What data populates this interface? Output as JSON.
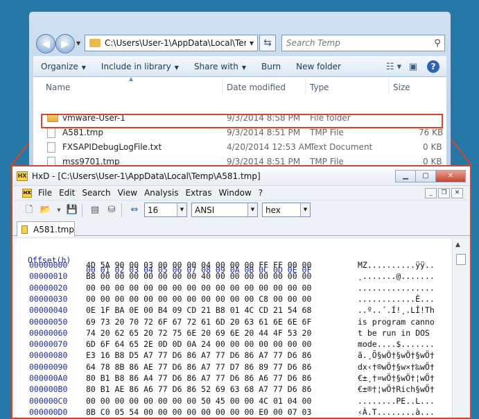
{
  "explorer": {
    "address_path": "C:\\Users\\User-1\\AppData\\Local\\Temp",
    "search_placeholder": "Search Temp",
    "commands": [
      "Organize",
      "Include in library",
      "Share with",
      "Burn",
      "New folder"
    ],
    "columns": {
      "name": "Name",
      "date": "Date modified",
      "type": "Type",
      "size": "Size"
    },
    "files": [
      {
        "name": "vmware-User-1",
        "date": "9/3/2014 8:58 PM",
        "type": "File folder",
        "size": "",
        "icon": "folder-icon"
      },
      {
        "name": "A581.tmp",
        "date": "9/3/2014 8:51 PM",
        "type": "TMP File",
        "size": "76 KB",
        "icon": "file-icon",
        "highlighted": true
      },
      {
        "name": "FXSAPIDebugLogFile.txt",
        "date": "4/20/2014 12:53 AM",
        "type": "Text Document",
        "size": "0 KB",
        "icon": "text-file-icon"
      },
      {
        "name": "mss9701.tmp",
        "date": "9/3/2014 8:51 PM",
        "type": "TMP File",
        "size": "0 KB",
        "icon": "file-icon"
      }
    ]
  },
  "hxd": {
    "title": "HxD - [C:\\Users\\User-1\\AppData\\Local\\Temp\\A581.tmp]",
    "menu": [
      "File",
      "Edit",
      "Search",
      "View",
      "Analysis",
      "Extras",
      "Window",
      "?"
    ],
    "bytes_per_row": "16",
    "charset": "ANSI",
    "offset_base": "hex",
    "tab_label": "A581.tmp",
    "offset_header": "Offset(h)",
    "column_header": "00 01 02 03 04 05 06 07 08 09 0A 0B 0C 0D 0E 0F",
    "rows": [
      {
        "offset": "00000000",
        "bytes": "4D 5A 90 00 03 00 00 00 04 00 00 00 FF FF 00 00",
        "ascii": "MZ..........ÿÿ.."
      },
      {
        "offset": "00000010",
        "bytes": "B8 00 00 00 00 00 00 00 40 00 00 00 00 00 00 00",
        "ascii": "¸.......@......."
      },
      {
        "offset": "00000020",
        "bytes": "00 00 00 00 00 00 00 00 00 00 00 00 00 00 00 00",
        "ascii": "................"
      },
      {
        "offset": "00000030",
        "bytes": "00 00 00 00 00 00 00 00 00 00 00 00 C8 00 00 00",
        "ascii": "............È..."
      },
      {
        "offset": "00000040",
        "bytes": "0E 1F BA 0E 00 B4 09 CD 21 B8 01 4C CD 21 54 68",
        "ascii": "..º..´.Í!¸.LÍ!Th"
      },
      {
        "offset": "00000050",
        "bytes": "69 73 20 70 72 6F 67 72 61 6D 20 63 61 6E 6E 6F",
        "ascii": "is program canno"
      },
      {
        "offset": "00000060",
        "bytes": "74 20 62 65 20 72 75 6E 20 69 6E 20 44 4F 53 20",
        "ascii": "t be run in DOS "
      },
      {
        "offset": "00000070",
        "bytes": "6D 6F 64 65 2E 0D 0D 0A 24 00 00 00 00 00 00 00",
        "ascii": "mode....$......."
      },
      {
        "offset": "00000080",
        "bytes": "E3 16 B8 D5 A7 77 D6 86 A7 77 D6 86 A7 77 D6 86",
        "ascii": "ã.¸Õ§wÖ†§wÖ†§wÖ†"
      },
      {
        "offset": "00000090",
        "bytes": "64 78 8B 86 AE 77 D6 86 A7 77 D7 86 89 77 D6 86",
        "ascii": "dx‹†®wÖ†§w×†‰wÖ†"
      },
      {
        "offset": "000000A0",
        "bytes": "80 B1 B8 86 A4 77 D6 86 A7 77 D6 86 A6 77 D6 86",
        "ascii": "€±¸†¤wÖ†§wÖ†¦wÖ†"
      },
      {
        "offset": "000000B0",
        "bytes": "80 B1 AE 86 A6 77 D6 86 52 69 63 68 A7 77 D6 86",
        "ascii": "€±®†¦wÖ†Rich§wÖ†"
      },
      {
        "offset": "000000C0",
        "bytes": "00 00 00 00 00 00 00 00 50 45 00 00 4C 01 04 00",
        "ascii": "........PE..L..."
      },
      {
        "offset": "000000D0",
        "bytes": "8B C0 05 54 00 00 00 00 00 00 00 00 E0 00 07 03",
        "ascii": "‹À.T........à..."
      }
    ]
  }
}
